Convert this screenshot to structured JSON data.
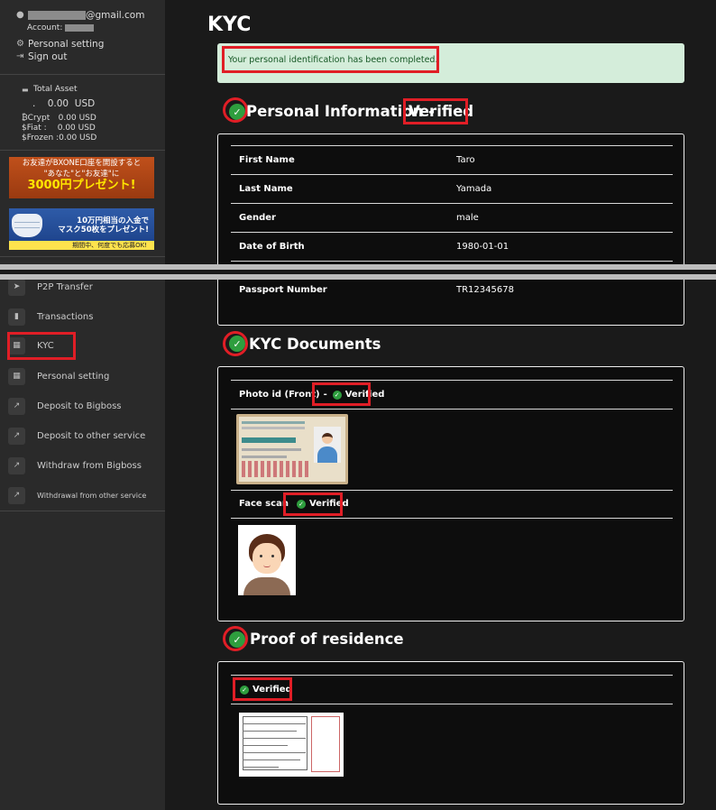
{
  "sidebar": {
    "email_suffix": "@gmail.com",
    "account_label": "Account:",
    "personal_setting": "Personal setting",
    "sign_out": "Sign out",
    "total_asset_label": "Total Asset",
    "total_asset_prefix": ".",
    "total_asset_value": "0.00",
    "total_asset_currency": "USD",
    "assets": [
      {
        "label": "Crypt",
        "value": "0.00 USD",
        "icon": "bitcoin-icon"
      },
      {
        "label": "Fiat :",
        "value": "0.00 USD",
        "icon": "dollar-icon"
      },
      {
        "label": "Frozen :",
        "value": "0.00 USD",
        "icon": "dollar-icon"
      }
    ],
    "banner1": {
      "line1": "お友達がBXONE口座を開設すると",
      "line2": "\"あなた\"と\"お友達\"に",
      "line3": "3000円プレゼント!"
    },
    "banner2": {
      "line1": "10万円相当の入金で",
      "line2": "マスク50枚をプレゼント!",
      "line3": "期間中、何度でも応募OK!"
    },
    "nav": [
      {
        "label": "P2P Transfer",
        "icon": "paper-plane-icon"
      },
      {
        "label": "Transactions",
        "icon": "book-icon"
      },
      {
        "label": "KYC",
        "icon": "calendar-icon"
      },
      {
        "label": "Personal setting",
        "icon": "calendar-icon"
      },
      {
        "label": "Deposit to Bigboss",
        "icon": "chart-icon"
      },
      {
        "label": "Deposit to other service",
        "icon": "chart-icon"
      },
      {
        "label": "Withdraw from Bigboss",
        "icon": "chart-icon"
      },
      {
        "label": "Withdrawal from other service",
        "icon": "chart-icon"
      }
    ]
  },
  "main": {
    "title": "KYC",
    "alert": "Your personal identification has been completed.",
    "personal": {
      "title": "Personal Information -",
      "status": "Verified",
      "rows": [
        {
          "label": "First Name",
          "value": "Taro"
        },
        {
          "label": "Last Name",
          "value": "Yamada"
        },
        {
          "label": "Gender",
          "value": "male"
        },
        {
          "label": "Date of Birth",
          "value": "1980-01-01"
        },
        {
          "label": "Passport Number",
          "value": "TR12345678"
        }
      ]
    },
    "documents": {
      "title": "KYC Documents",
      "photo_id_label": "Photo id (Front)",
      "photo_id_sep": "-",
      "photo_id_status": "Verified",
      "face_label": "Face scan",
      "face_status": "Verified"
    },
    "residence": {
      "title": "Proof of residence",
      "status": "Verified"
    }
  },
  "colors": {
    "highlight": "#e01e26",
    "verified_green": "#2e9e3e",
    "alert_bg": "#d4edda"
  }
}
